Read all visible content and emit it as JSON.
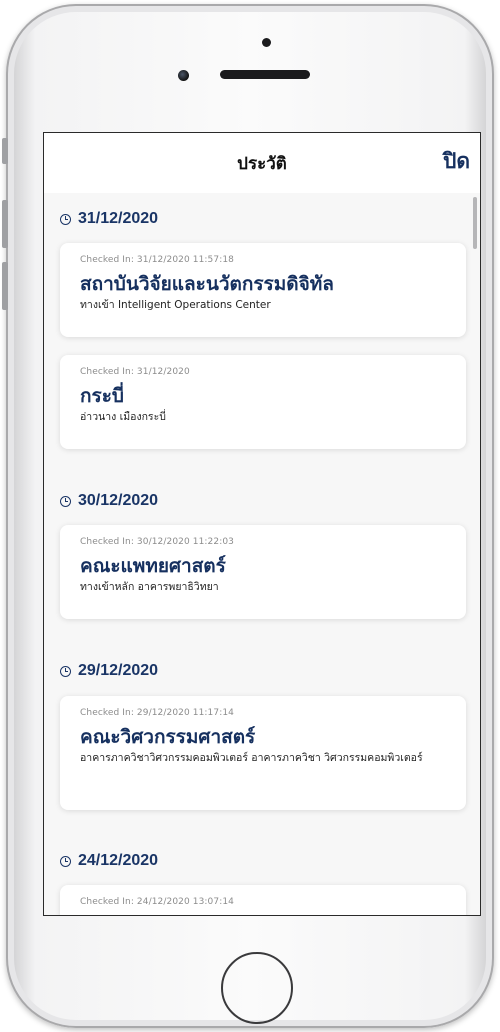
{
  "header": {
    "title": "ประวัติ",
    "close_label": "ปิด"
  },
  "history": [
    {
      "date": "31/12/2020",
      "entries": [
        {
          "checked_in": "Checked In: 31/12/2020 11:57:18",
          "place": "สถาบันวิจัยและนวัตกรรมดิจิทัล",
          "detail": "ทางเข้า Intelligent Operations Center"
        },
        {
          "checked_in": "Checked In: 31/12/2020",
          "place": "กระบี่",
          "detail": "อ่าวนาง เมืองกระบี่"
        }
      ]
    },
    {
      "date": "30/12/2020",
      "entries": [
        {
          "checked_in": "Checked In: 30/12/2020 11:22:03",
          "place": "คณะแพทยศาสตร์",
          "detail": "ทางเข้าหลัก อาคารพยาธิวิทยา"
        }
      ]
    },
    {
      "date": "29/12/2020",
      "entries": [
        {
          "checked_in": "Checked In: 29/12/2020 11:17:14",
          "place": "คณะวิศวกรรมศาสตร์",
          "detail": "อาคารภาควิชาวิศวกรรมคอมพิวเตอร์ อาคารภาควิชา วิศวกรรมคอมพิวเตอร์"
        }
      ]
    },
    {
      "date": "24/12/2020",
      "entries": [
        {
          "checked_in": "Checked In: 24/12/2020 13:07:14"
        }
      ]
    }
  ]
}
